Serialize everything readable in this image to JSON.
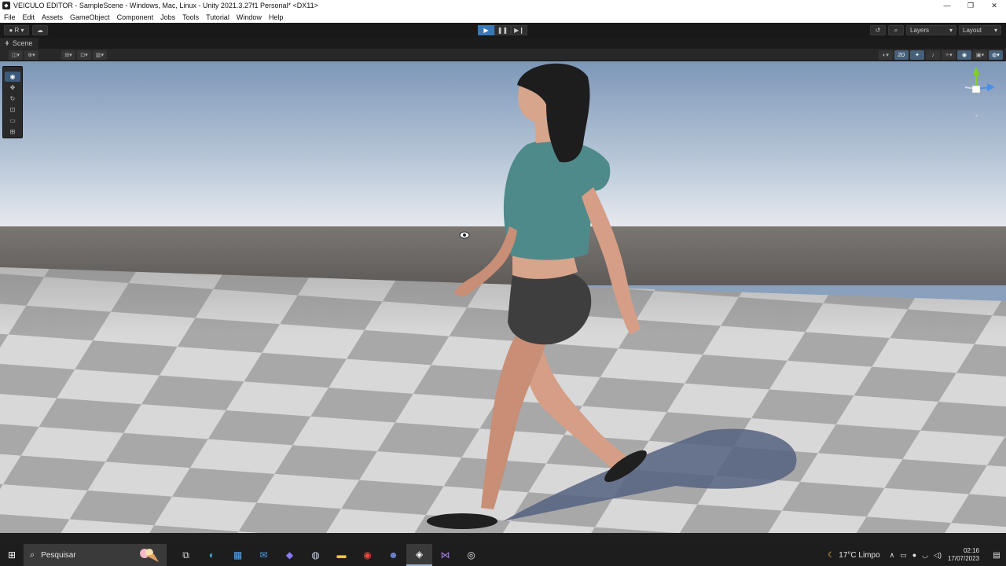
{
  "window": {
    "title": "VEICULO EDITOR - SampleScene - Windows, Mac, Linux - Unity 2021.3.27f1 Personal* <DX11>",
    "controls": [
      "—",
      "❐",
      "✕"
    ]
  },
  "menu": [
    "File",
    "Edit",
    "Assets",
    "GameObject",
    "Component",
    "Jobs",
    "Tools",
    "Tutorial",
    "Window",
    "Help"
  ],
  "toolbar": {
    "account": "R",
    "layers": "Layers",
    "layout": "Layout"
  },
  "scene": {
    "tab_label": "Scene",
    "mode_2d": "2D"
  },
  "taskbar": {
    "search_placeholder": "Pesquisar",
    "weather": "17°C  Limpo",
    "time": "02:16",
    "date": "17/07/2023"
  },
  "colors": {
    "play_accent": "#3a78b5",
    "sky_top": "#8aa1bd",
    "horizon": "#e8ebee",
    "floor_light": "#d6d6d6",
    "floor_dark": "#a9a9a9"
  }
}
